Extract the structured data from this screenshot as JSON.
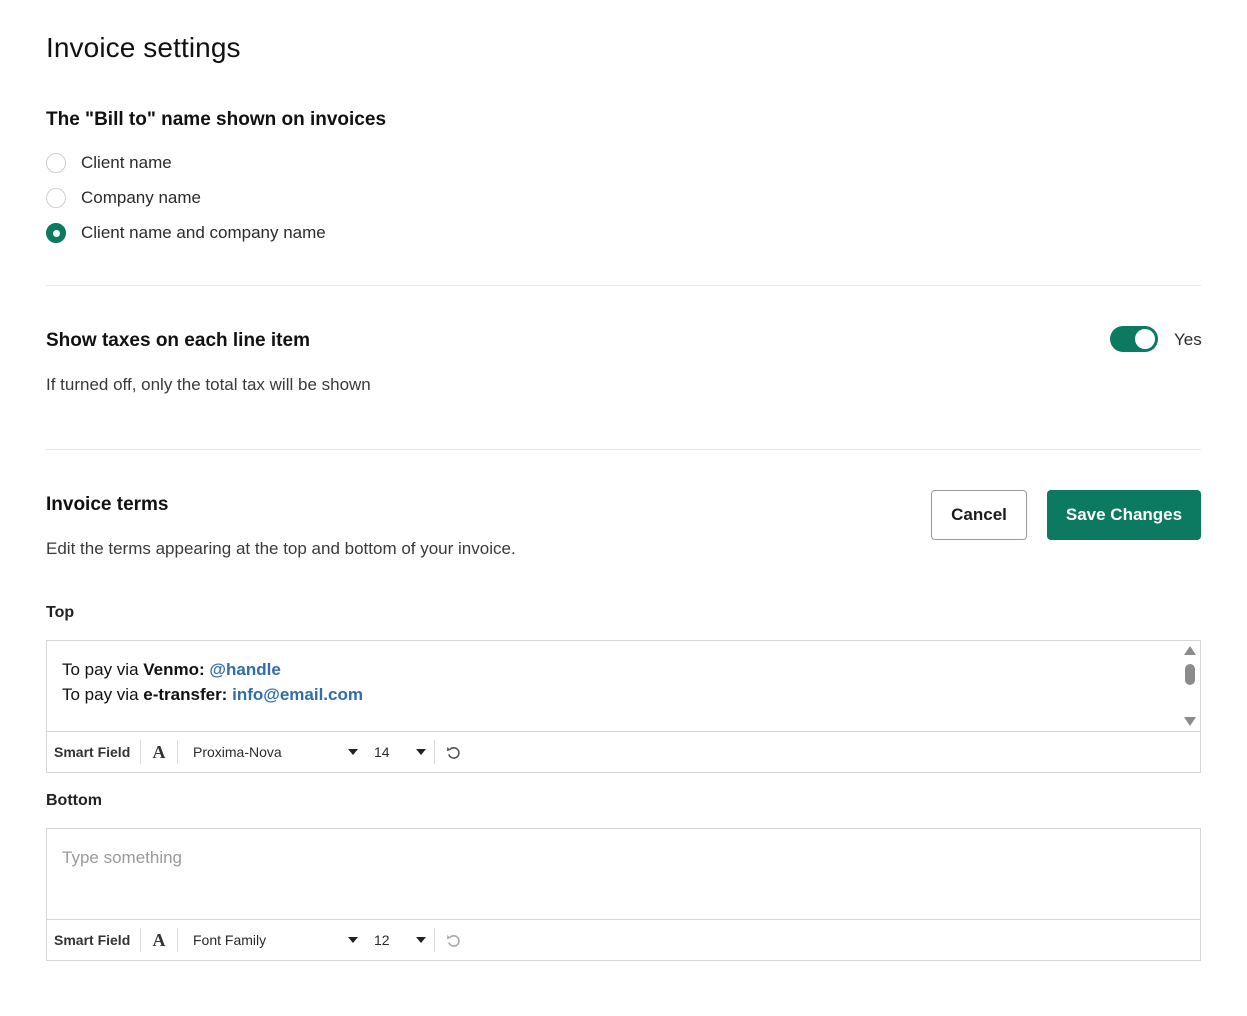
{
  "page": {
    "title": "Invoice settings"
  },
  "bill_to": {
    "heading": "The \"Bill to\" name shown on invoices",
    "options": [
      {
        "label": "Client name",
        "checked": false
      },
      {
        "label": "Company name",
        "checked": false
      },
      {
        "label": "Client name and company name",
        "checked": true
      }
    ]
  },
  "taxes": {
    "heading": "Show taxes on each line item",
    "description": "If turned off, only the total tax will be shown",
    "toggle_on": true,
    "toggle_label": "Yes"
  },
  "terms": {
    "heading": "Invoice terms",
    "description": "Edit the terms appearing at the top and bottom of your invoice.",
    "cancel_label": "Cancel",
    "save_label": "Save Changes",
    "top": {
      "label": "Top",
      "line1": {
        "prefix": "To pay via ",
        "bold": "Venmo:",
        "link": "@handle"
      },
      "line2": {
        "prefix": "To pay via ",
        "bold": "e-transfer:",
        "link": "info@email.com"
      },
      "toolbar": {
        "smart_field": "Smart Field",
        "font_icon": "A",
        "font_family": "Proxima-Nova",
        "font_size": "14"
      }
    },
    "bottom": {
      "label": "Bottom",
      "placeholder": "Type something",
      "toolbar": {
        "smart_field": "Smart Field",
        "font_icon": "A",
        "font_family": "Font Family",
        "font_size": "12"
      }
    }
  },
  "colors": {
    "accent": "#0c7a60",
    "link": "#2f6ea8"
  }
}
